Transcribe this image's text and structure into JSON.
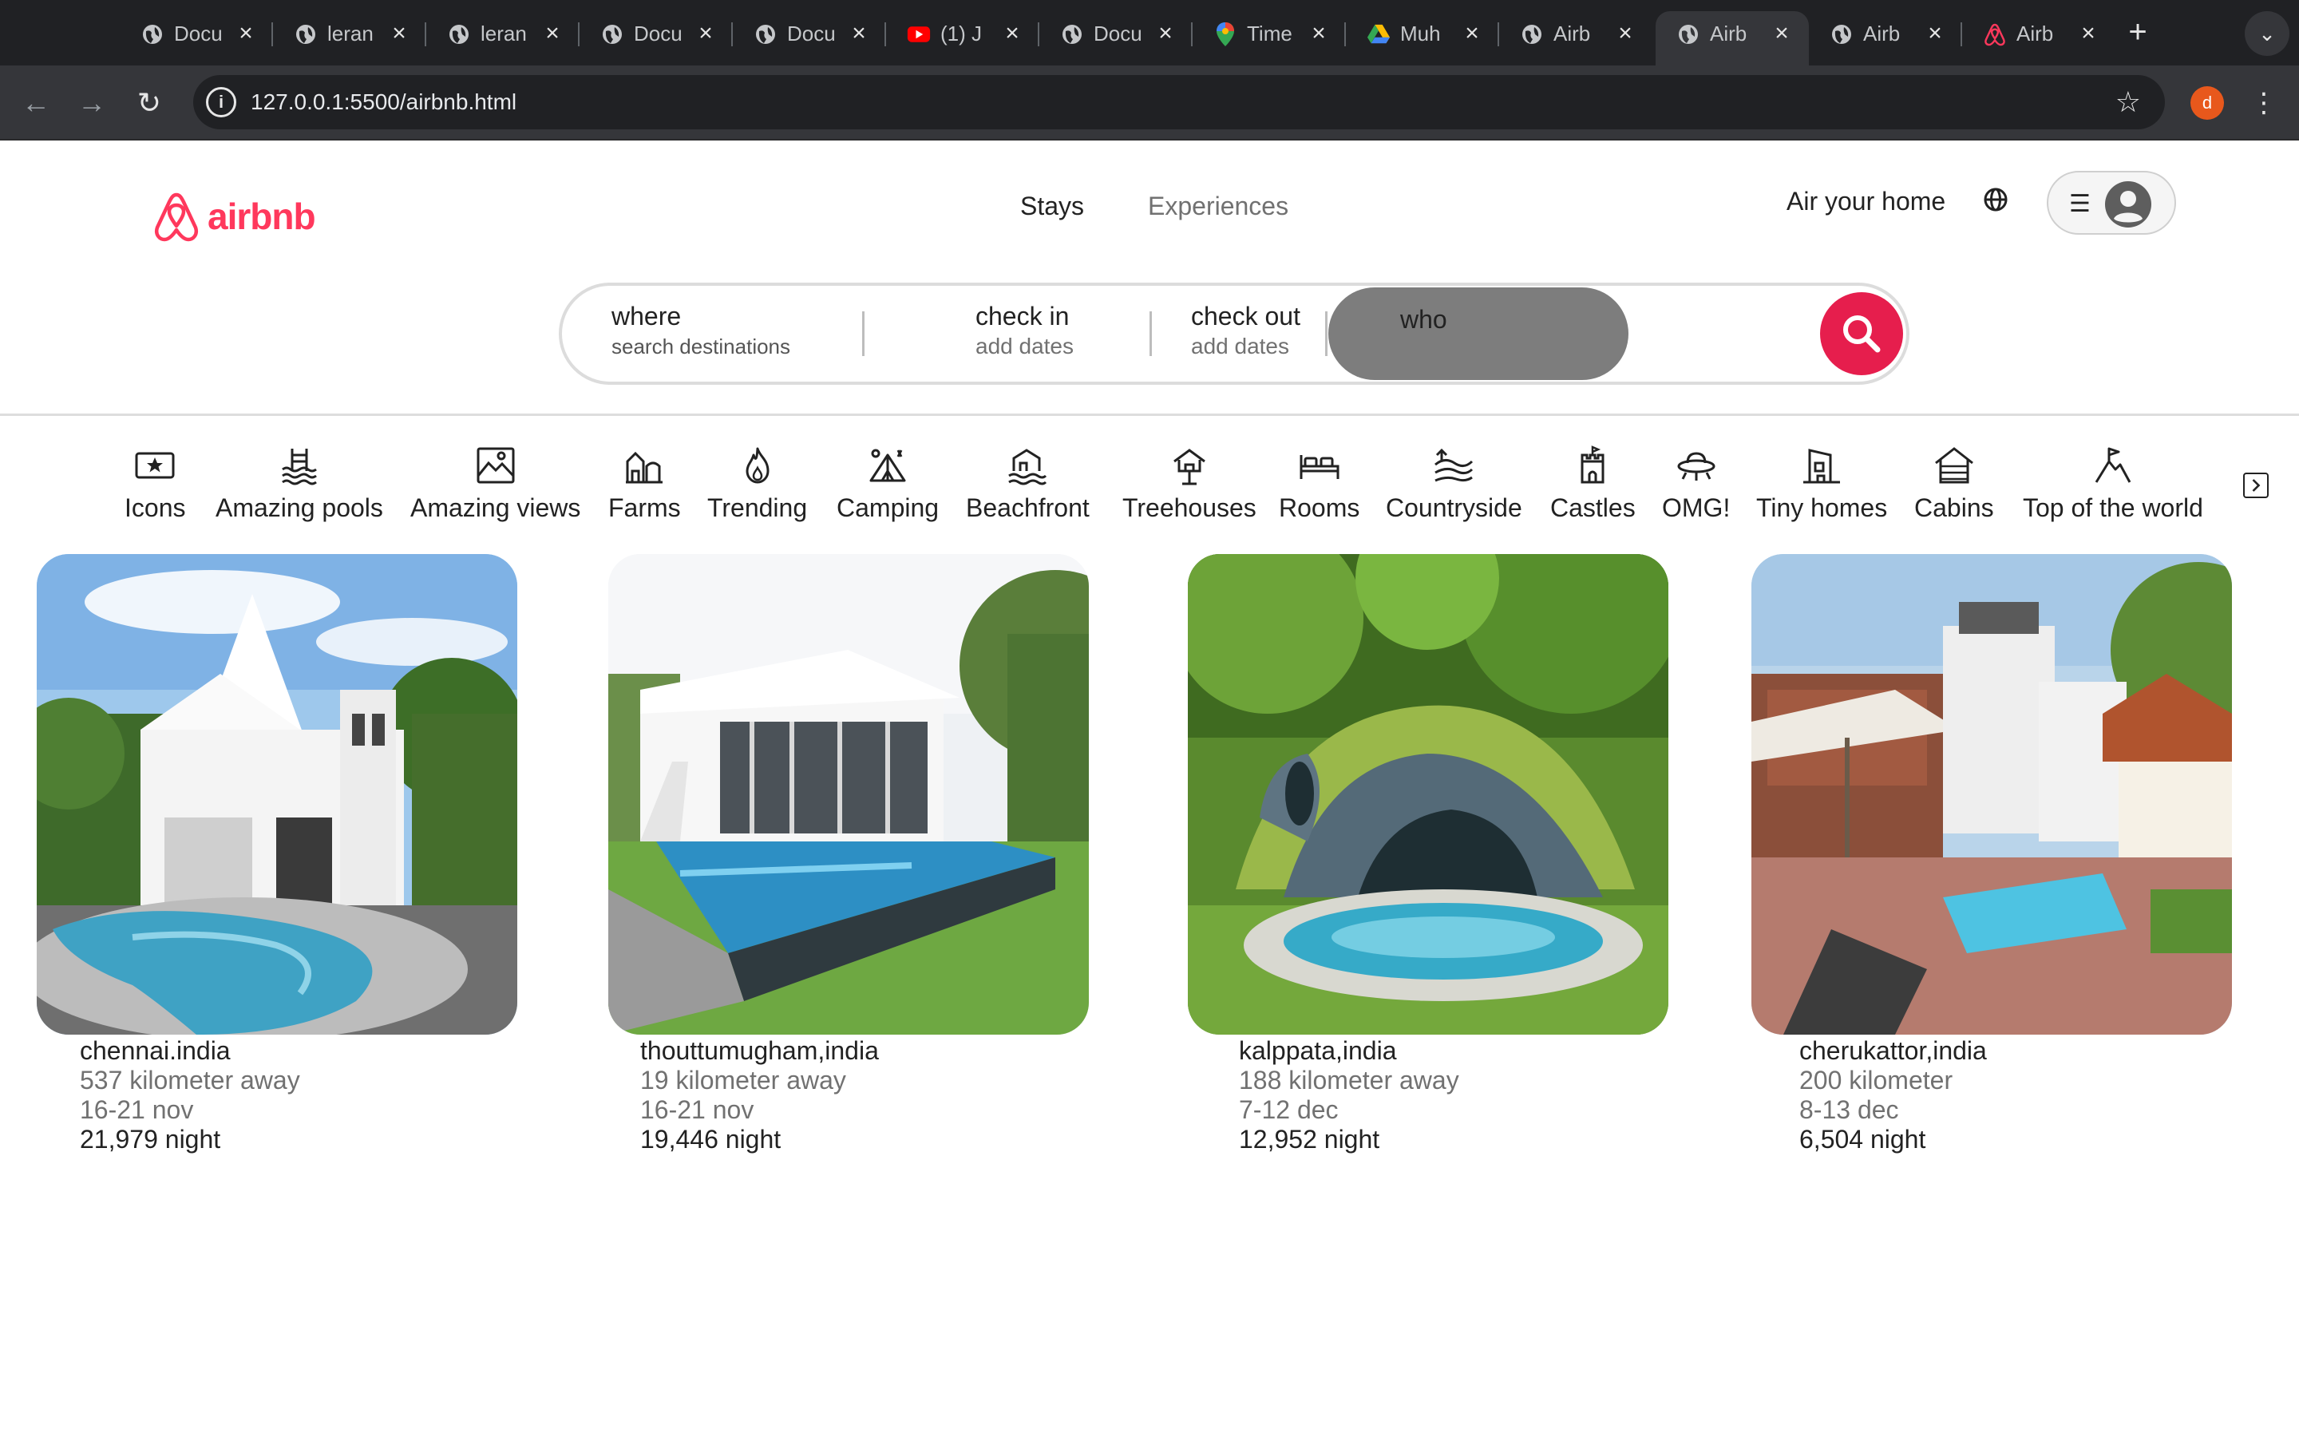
{
  "browser": {
    "tabs": [
      {
        "title": "Docu",
        "icon": "globe-icon"
      },
      {
        "title": "leran",
        "icon": "globe-icon"
      },
      {
        "title": "leran",
        "icon": "globe-icon"
      },
      {
        "title": "Docu",
        "icon": "globe-icon"
      },
      {
        "title": "Docu",
        "icon": "globe-icon"
      },
      {
        "title": "(1) J",
        "icon": "youtube-icon"
      },
      {
        "title": "Docu",
        "icon": "globe-icon"
      },
      {
        "title": "Time",
        "icon": "maps-pin-icon"
      },
      {
        "title": "Muh",
        "icon": "drive-icon"
      },
      {
        "title": "Airb",
        "icon": "globe-icon"
      },
      {
        "title": "Airb",
        "icon": "globe-icon"
      },
      {
        "title": "Airb",
        "icon": "globe-icon"
      },
      {
        "title": "Airb",
        "icon": "airbnb-icon"
      }
    ],
    "url": "127.0.0.1:5500/airbnb.html",
    "profile_initial": "d"
  },
  "header": {
    "brand": "airbnb",
    "nav": {
      "stays": "Stays",
      "experiences": "Experiences"
    },
    "air_your_home": "Air your home"
  },
  "search": {
    "where_label": "where",
    "where_sub": "search destinations",
    "checkin_label": "check in",
    "checkin_sub": "add dates",
    "checkout_label": "check out",
    "checkout_sub": "add dates",
    "who_label": "who"
  },
  "categories": [
    {
      "label": "Icons",
      "icon": "icons-icon"
    },
    {
      "label": "Amazing pools",
      "icon": "pool-icon"
    },
    {
      "label": "Amazing views",
      "icon": "views-icon"
    },
    {
      "label": "Farms",
      "icon": "farm-icon"
    },
    {
      "label": "Trending",
      "icon": "flame-icon"
    },
    {
      "label": "Camping",
      "icon": "tent-icon"
    },
    {
      "label": "Beachfront",
      "icon": "beach-icon"
    },
    {
      "label": "Treehouses",
      "icon": "treehouse-icon"
    },
    {
      "label": "Rooms",
      "icon": "bed-icon"
    },
    {
      "label": "Countryside",
      "icon": "countryside-icon"
    },
    {
      "label": "Castles",
      "icon": "castle-icon"
    },
    {
      "label": "OMG!",
      "icon": "ufo-icon"
    },
    {
      "label": "Tiny homes",
      "icon": "tiny-home-icon"
    },
    {
      "label": "Cabins",
      "icon": "cabin-icon"
    },
    {
      "label": "Top of the world",
      "icon": "mountain-flag-icon"
    }
  ],
  "listings": [
    {
      "location": "chennai.india",
      "distance": "537 kilometer away",
      "dates": "16-21 nov",
      "price": "21,979 night"
    },
    {
      "location": "thouttumugham,india",
      "distance": "19 kilometer away",
      "dates": "16-21 nov",
      "price": "19,446 night"
    },
    {
      "location": "kalppata,india",
      "distance": "188 kilometer away",
      "dates": "7-12 dec",
      "price": "12,952 night"
    },
    {
      "location": "cherukattor,india",
      "distance": "200 kilometer",
      "dates": "8-13 dec",
      "price": "6,504 night"
    }
  ],
  "colors": {
    "brand": "#ff385c",
    "search_button": "#e61e4d",
    "who_highlight": "#7d7d7d"
  }
}
